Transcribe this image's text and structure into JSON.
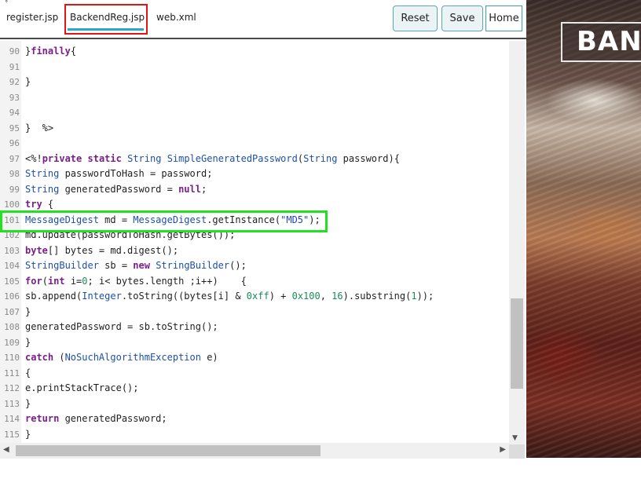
{
  "tabs": [
    {
      "label": "register.jsp"
    },
    {
      "label": "BackendReg.jsp",
      "active": true
    },
    {
      "label": "web.xml"
    }
  ],
  "corner_mark": "˚",
  "buttons": {
    "reset": "Reset",
    "save": "Save",
    "home": "Home"
  },
  "editor": {
    "lines": [
      {
        "n": "90",
        "code": "}finally{"
      },
      {
        "n": "91",
        "code": ""
      },
      {
        "n": "92",
        "code": "}"
      },
      {
        "n": "93",
        "code": ""
      },
      {
        "n": "94",
        "code": ""
      },
      {
        "n": "95",
        "code": "}  %>"
      },
      {
        "n": "96",
        "code": ""
      },
      {
        "n": "97",
        "code": "<%!private static String SimpleGeneratedPassword(String password){"
      },
      {
        "n": "98",
        "code": "String passwordToHash = password;"
      },
      {
        "n": "99",
        "code": "String generatedPassword = null;"
      },
      {
        "n": "100",
        "code": "try {"
      },
      {
        "n": "101",
        "code": "MessageDigest md = MessageDigest.getInstance(\"MD5\");"
      },
      {
        "n": "102",
        "code": "md.update(passwordToHash.getBytes());"
      },
      {
        "n": "103",
        "code": "byte[] bytes = md.digest();"
      },
      {
        "n": "104",
        "code": "StringBuilder sb = new StringBuilder();"
      },
      {
        "n": "105",
        "code": "for(int i=0; i< bytes.length ;i++)    {"
      },
      {
        "n": "106",
        "code": "sb.append(Integer.toString((bytes[i] & 0xff) + 0x100, 16).substring(1));"
      },
      {
        "n": "107",
        "code": "}"
      },
      {
        "n": "108",
        "code": "generatedPassword = sb.toString();"
      },
      {
        "n": "109",
        "code": "}"
      },
      {
        "n": "110",
        "code": "catch (NoSuchAlgorithmException e)"
      },
      {
        "n": "111",
        "code": "{"
      },
      {
        "n": "112",
        "code": "e.printStackTrace();"
      },
      {
        "n": "113",
        "code": "}"
      },
      {
        "n": "114",
        "code": "return generatedPassword;"
      },
      {
        "n": "115",
        "code": "}"
      }
    ],
    "highlighted_line": "101"
  },
  "banner": {
    "logo_text": "BAN"
  },
  "colors": {
    "active_tab_underline": "#2aa7c9",
    "tab_highlight_box": "#e01515",
    "line_highlight_box": "#22e022",
    "keyword": "#7a1f8a",
    "type": "#1f4fa8",
    "string": "#2343c8"
  },
  "icons": {
    "scroll_down": "triangle-down",
    "scroll_left": "triangle-left",
    "scroll_right": "triangle-right"
  }
}
